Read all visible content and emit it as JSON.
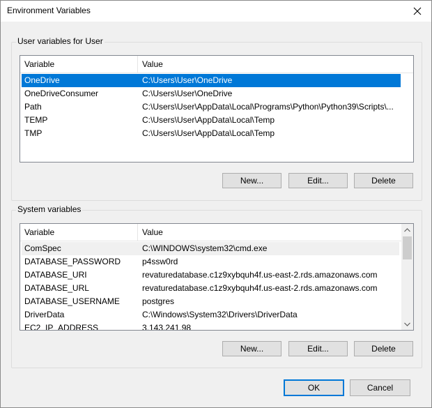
{
  "window": {
    "title": "Environment Variables"
  },
  "user_vars": {
    "group_label": "User variables for User",
    "columns": {
      "variable": "Variable",
      "value": "Value"
    },
    "rows": [
      {
        "name": "OneDrive",
        "value": "C:\\Users\\User\\OneDrive"
      },
      {
        "name": "OneDriveConsumer",
        "value": "C:\\Users\\User\\OneDrive"
      },
      {
        "name": "Path",
        "value": "C:\\Users\\User\\AppData\\Local\\Programs\\Python\\Python39\\Scripts\\..."
      },
      {
        "name": "TEMP",
        "value": "C:\\Users\\User\\AppData\\Local\\Temp"
      },
      {
        "name": "TMP",
        "value": "C:\\Users\\User\\AppData\\Local\\Temp"
      }
    ],
    "selected_row": "OneDrive",
    "buttons": {
      "new": "New...",
      "edit": "Edit...",
      "delete": "Delete"
    }
  },
  "system_vars": {
    "group_label": "System variables",
    "columns": {
      "variable": "Variable",
      "value": "Value"
    },
    "rows": [
      {
        "name": "ComSpec",
        "value": "C:\\WINDOWS\\system32\\cmd.exe"
      },
      {
        "name": "DATABASE_PASSWORD",
        "value": "p4ssw0rd"
      },
      {
        "name": "DATABASE_URI",
        "value": "revaturedatabase.c1z9xybquh4f.us-east-2.rds.amazonaws.com"
      },
      {
        "name": "DATABASE_URL",
        "value": "revaturedatabase.c1z9xybquh4f.us-east-2.rds.amazonaws.com"
      },
      {
        "name": "DATABASE_USERNAME",
        "value": "postgres"
      },
      {
        "name": "DriverData",
        "value": "C:\\Windows\\System32\\Drivers\\DriverData"
      },
      {
        "name": "EC2_IP_ADDRESS",
        "value": "3.143.241.98"
      }
    ],
    "focused_row": "ComSpec",
    "buttons": {
      "new": "New...",
      "edit": "Edit...",
      "delete": "Delete"
    }
  },
  "dialog_buttons": {
    "ok": "OK",
    "cancel": "Cancel"
  },
  "colors": {
    "selection": "#0078d7",
    "default_button_border": "#0078d7",
    "button_face": "#e1e1e1"
  },
  "icons": {
    "close": "close-icon",
    "scroll_up": "chevron-up-icon",
    "scroll_down": "chevron-down-icon"
  }
}
